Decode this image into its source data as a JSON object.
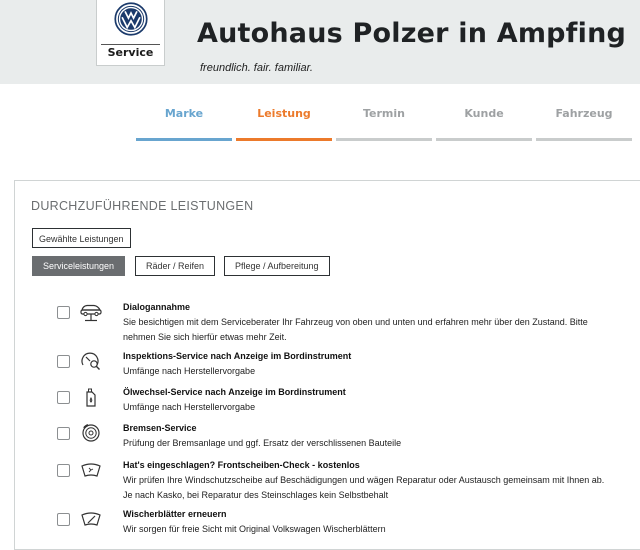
{
  "header": {
    "logo_label": "Service",
    "dealer_title": "Autohaus Polzer in Ampfing",
    "tagline": "freundlich. fair. familiar."
  },
  "steps": [
    {
      "label": "Marke",
      "state": "done"
    },
    {
      "label": "Leistung",
      "state": "active"
    },
    {
      "label": "Termin",
      "state": "upcoming"
    },
    {
      "label": "Kunde",
      "state": "upcoming"
    },
    {
      "label": "Fahrzeug",
      "state": "upcoming"
    }
  ],
  "panel": {
    "title": "DURCHZUFÜHRENDE LEISTUNGEN",
    "selected_button": "Gewählte Leistungen",
    "tabs": [
      {
        "label": "Serviceleistungen",
        "active": true
      },
      {
        "label": "Räder / Reifen",
        "active": false
      },
      {
        "label": "Pflege / Aufbereitung",
        "active": false
      }
    ]
  },
  "services": [
    {
      "icon": "car-lift-icon",
      "title": "Dialogannahme",
      "desc": "Sie besichtigen mit dem Serviceberater Ihr Fahrzeug von oben und unten und erfahren mehr über den Zustand. Bitte nehmen Sie sich hierfür etwas mehr Zeit.",
      "checked": false
    },
    {
      "icon": "gauge-search-icon",
      "title": "Inspektions-Service nach Anzeige im Bordinstrument",
      "desc": "Umfänge nach Herstellervorgabe",
      "checked": false
    },
    {
      "icon": "oil-can-icon",
      "title": "Ölwechsel-Service nach Anzeige im Bordinstrument",
      "desc": "Umfänge nach Herstellervorgabe",
      "checked": false
    },
    {
      "icon": "brake-disc-icon",
      "title": "Bremsen-Service",
      "desc": "Prüfung der Bremsanlage und ggf. Ersatz der verschlissenen Bauteile",
      "checked": false
    },
    {
      "icon": "windshield-icon",
      "title": "Hat's eingeschlagen? Frontscheiben-Check - kostenlos",
      "desc": "Wir prüfen Ihre Windschutzscheibe auf Beschädigungen und wägen Reparatur oder Austausch gemeinsam mit Ihnen ab. Je nach Kasko, bei Reparatur des Steinschlages kein Selbstbehalt",
      "checked": false
    },
    {
      "icon": "wiper-icon",
      "title": "Wischerblätter erneuern",
      "desc": "Wir sorgen für freie Sicht mit Original Volkswagen Wischerblättern",
      "checked": false
    }
  ]
}
